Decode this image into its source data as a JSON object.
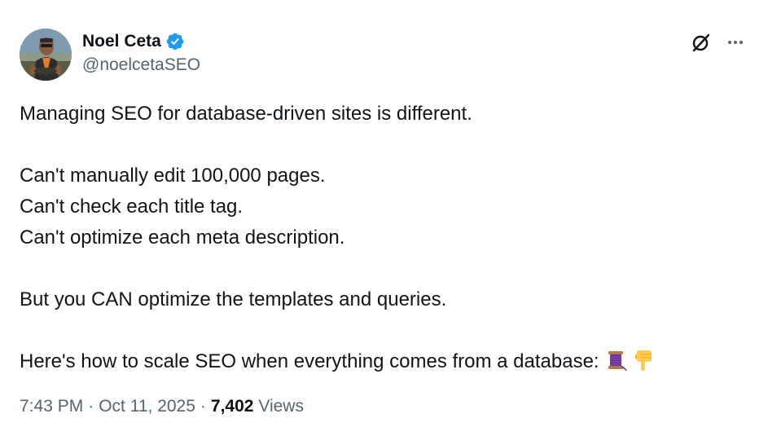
{
  "author": {
    "display_name": "Noel Ceta",
    "handle": "@noelcetaSEO",
    "verified": true,
    "verified_color": "#1d9bf0"
  },
  "icons": {
    "grok": "grok-icon",
    "more": "more-options-icon",
    "verified": "verified-badge-icon",
    "thread_emoji": "thread-spool-emoji",
    "point_down_emoji": "backhand-index-pointing-down-emoji"
  },
  "tweet": {
    "lines": [
      "Managing SEO for database-driven sites is different.",
      "",
      "Can't manually edit 100,000 pages.",
      "Can't check each title tag.",
      "Can't optimize each meta description.",
      "",
      "But you CAN optimize the templates and queries.",
      "",
      "Here's how to scale SEO when everything comes from a database:"
    ]
  },
  "meta": {
    "time": "7:43 PM",
    "separator": "·",
    "date": "Oct 11, 2025",
    "views_count": "7,402",
    "views_label": "Views"
  },
  "colors": {
    "text_primary": "#0f1419",
    "text_secondary": "#536471",
    "accent": "#1d9bf0"
  }
}
